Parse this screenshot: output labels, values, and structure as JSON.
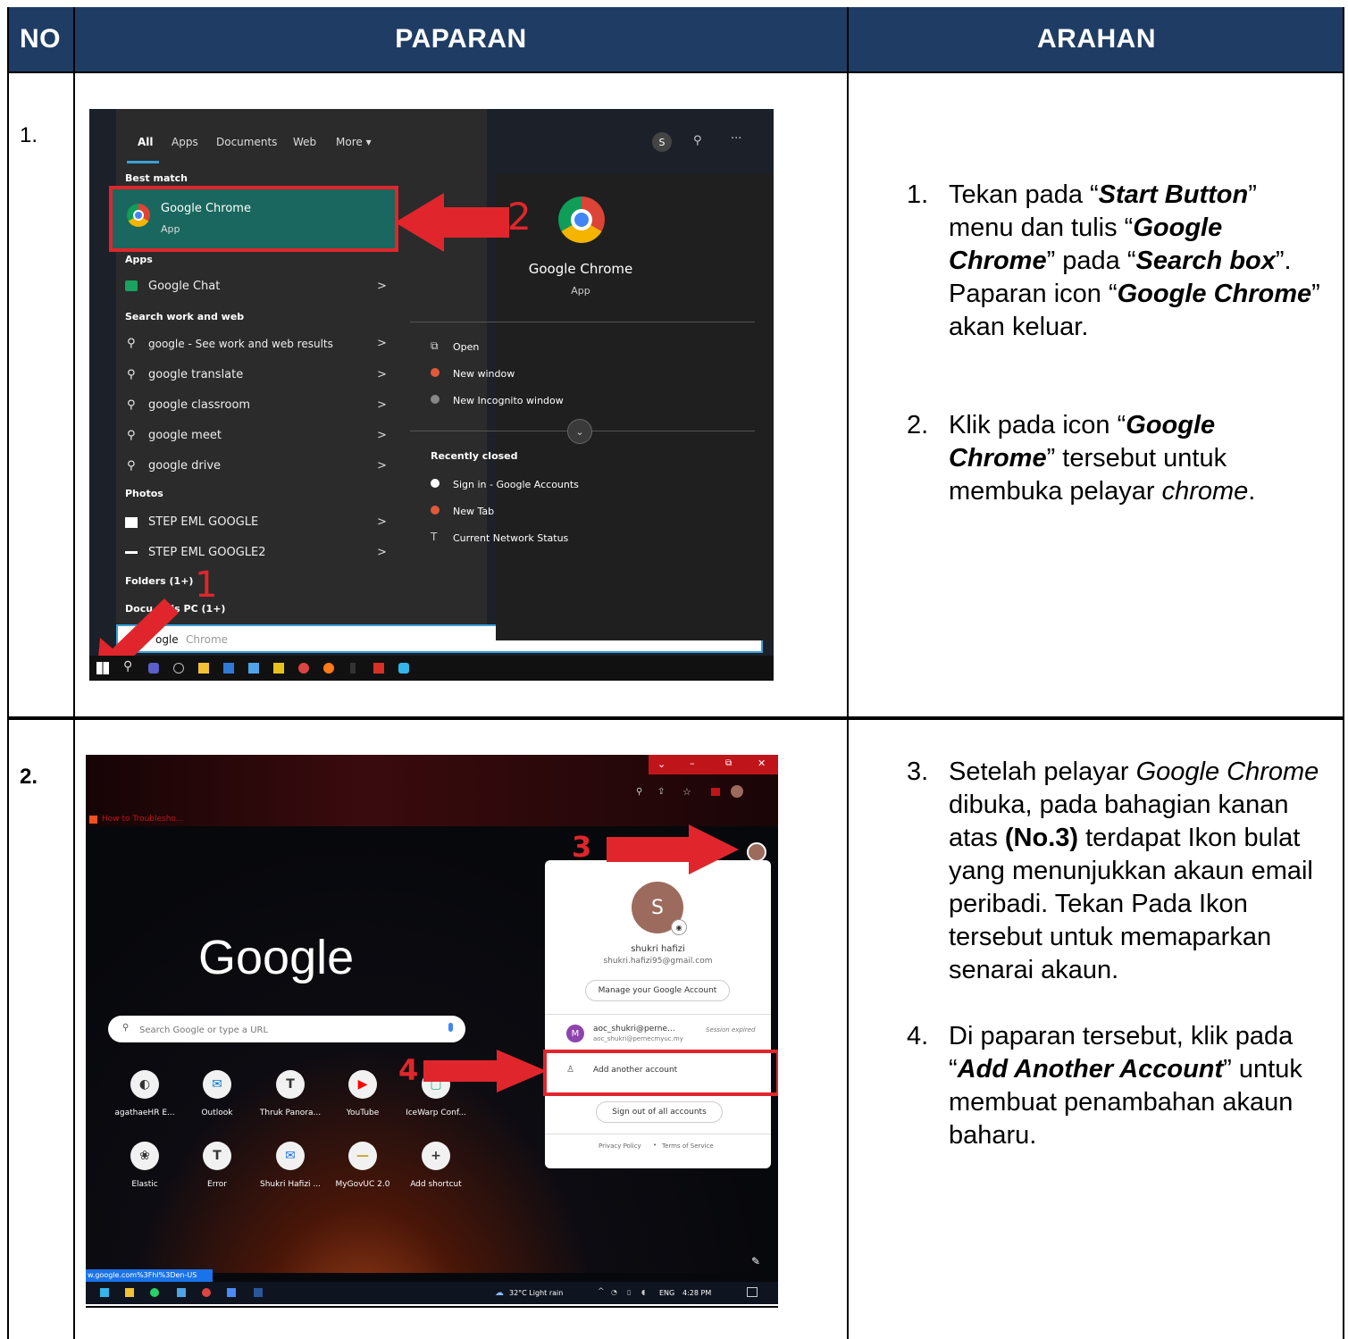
{
  "header": {
    "no": "NO",
    "paparan": "PAPARAN",
    "arahan": "ARAHAN"
  },
  "rows": [
    {
      "no": "1.",
      "instructions": [
        {
          "num": "1.",
          "parts": [
            "Tekan pada “",
            "Start Button",
            "” menu dan tulis “",
            "Google Chrome",
            "” pada “",
            "Search box",
            "”. Paparan icon “",
            "Google Chrome",
            "” akan keluar."
          ]
        },
        {
          "num": "2.",
          "parts": [
            "Klik pada icon “",
            "Google Chrome",
            "” tersebut untuk membuka pelayar ",
            "chrome",
            "."
          ]
        }
      ],
      "screenshot": {
        "tabs": [
          "All",
          "Apps",
          "Documents",
          "Web",
          "More ▾"
        ],
        "avatar": "S",
        "best_match_label": "Best match",
        "best_match_title": "Google Chrome",
        "best_match_sub": "App",
        "apps_label": "Apps",
        "google_chat": "Google Chat",
        "search_label": "Search work and web",
        "searches": [
          "google - See work and web results",
          "google translate",
          "google classroom",
          "google meet",
          "google drive"
        ],
        "photos_label": "Photos",
        "photos": [
          "STEP EML GOOGLE",
          "STEP EML GOOGLE2"
        ],
        "folders_label": "Folders (1+)",
        "docs_label": "Docu...nis PC (1+)",
        "search_box_text": "ogle",
        "search_box_hint": "Chrome",
        "right_title": "Google Chrome",
        "right_sub": "App",
        "actions": [
          "Open",
          "New window",
          "New Incognito window"
        ],
        "recent_label": "Recently closed",
        "recent": [
          "Sign in - Google Accounts",
          "New Tab",
          "Current Network Status"
        ],
        "marker1": "1",
        "marker2": "2"
      }
    },
    {
      "no": "2.",
      "instructions": [
        {
          "num": "3.",
          "parts": [
            "Setelah pelayar ",
            "Google Chrome",
            " dibuka, pada bahagian kanan atas ",
            "(No.3)",
            " terdapat Ikon bulat yang menunjukkan akaun email peribadi. Tekan Pada Ikon tersebut untuk memaparkan senarai akaun."
          ]
        },
        {
          "num": "4.",
          "parts": [
            "Di paparan tersebut, klik pada “",
            "Add Another Account",
            "” untuk membuat penambahan akaun baharu."
          ]
        }
      ],
      "screenshot": {
        "tab_title": "How to Troublesho...",
        "google_logo": "Google",
        "search_placeholder": "Search Google or type a URL",
        "shortcuts_row1": [
          "agathaeHR E...",
          "Outlook",
          "Thruk Panora...",
          "YouTube",
          "IceWarp Conf..."
        ],
        "shortcuts_row2": [
          "Elastic",
          "Error",
          "Shukri Hafizi ...",
          "MyGovUC 2.0",
          "Add shortcut"
        ],
        "profile_initial": "S",
        "profile_name": "shukri hafizi",
        "profile_email": "shukri.hafizi95@gmail.com",
        "manage_button": "Manage your Google Account",
        "other_initial": "M",
        "other_account": "aoc_shukri@perne...",
        "other_email": "aoc_shukri@pernecmyuc.my",
        "session_expired": "Session expired",
        "add_account": "Add another account",
        "sign_out": "Sign out of all accounts",
        "privacy": "Privacy Policy",
        "terms": "Terms of Service",
        "status_url": "w.google.com%3Fhl%3Den-US",
        "weather": "32°C  Light rain",
        "lang": "ENG",
        "time": "4:28 PM",
        "marker3": "3",
        "marker4": "4"
      }
    }
  ],
  "colors": {
    "header": "#1f3d64",
    "marker": "#e0262c"
  }
}
